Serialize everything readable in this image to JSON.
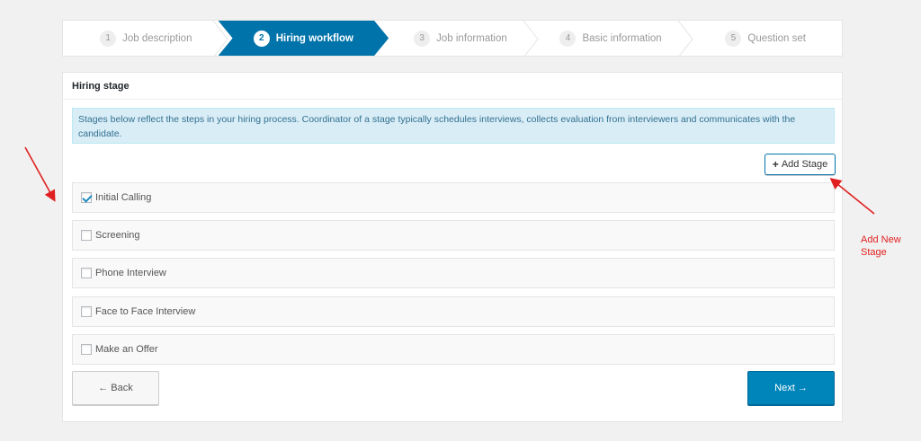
{
  "stepper": {
    "steps": [
      {
        "num": "1",
        "label": "Job description"
      },
      {
        "num": "2",
        "label": "Hiring workflow"
      },
      {
        "num": "3",
        "label": "Job information"
      },
      {
        "num": "4",
        "label": "Basic information"
      },
      {
        "num": "5",
        "label": "Question set"
      }
    ],
    "active_index": 1
  },
  "panel": {
    "title": "Hiring stage",
    "info": "Stages below reflect the steps in your hiring process. Coordinator of a stage typically schedules interviews, collects evaluation from interviewers and communicates with the candidate.",
    "add_stage_label": "Add Stage",
    "stages": [
      {
        "label": "Initial Calling",
        "checked": true
      },
      {
        "label": "Screening",
        "checked": false
      },
      {
        "label": "Phone Interview",
        "checked": false
      },
      {
        "label": "Face to Face Interview",
        "checked": false
      },
      {
        "label": "Make an Offer",
        "checked": false
      }
    ],
    "back_label": "← Back",
    "next_label": "Next →"
  },
  "annotation": {
    "line1": "Add New",
    "line2": "Stage"
  },
  "colors": {
    "primary": "#0073aa",
    "button_blue": "#0085ba",
    "annotation_red": "#e02020",
    "info_bg": "#d9edf7"
  }
}
